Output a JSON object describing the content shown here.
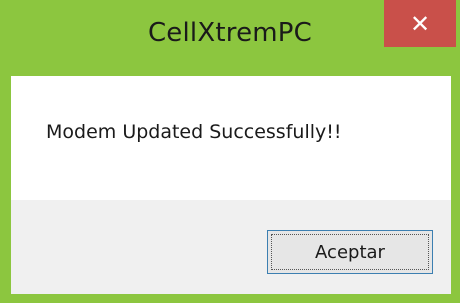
{
  "window": {
    "title": "CellXtremPC",
    "close_glyph": "✕",
    "close_icon": "close-icon",
    "frame_color": "#8cc63f",
    "close_color": "#c9504a"
  },
  "dialog": {
    "message": "Modem Updated Successfully!!",
    "ok_label": "Aceptar"
  }
}
